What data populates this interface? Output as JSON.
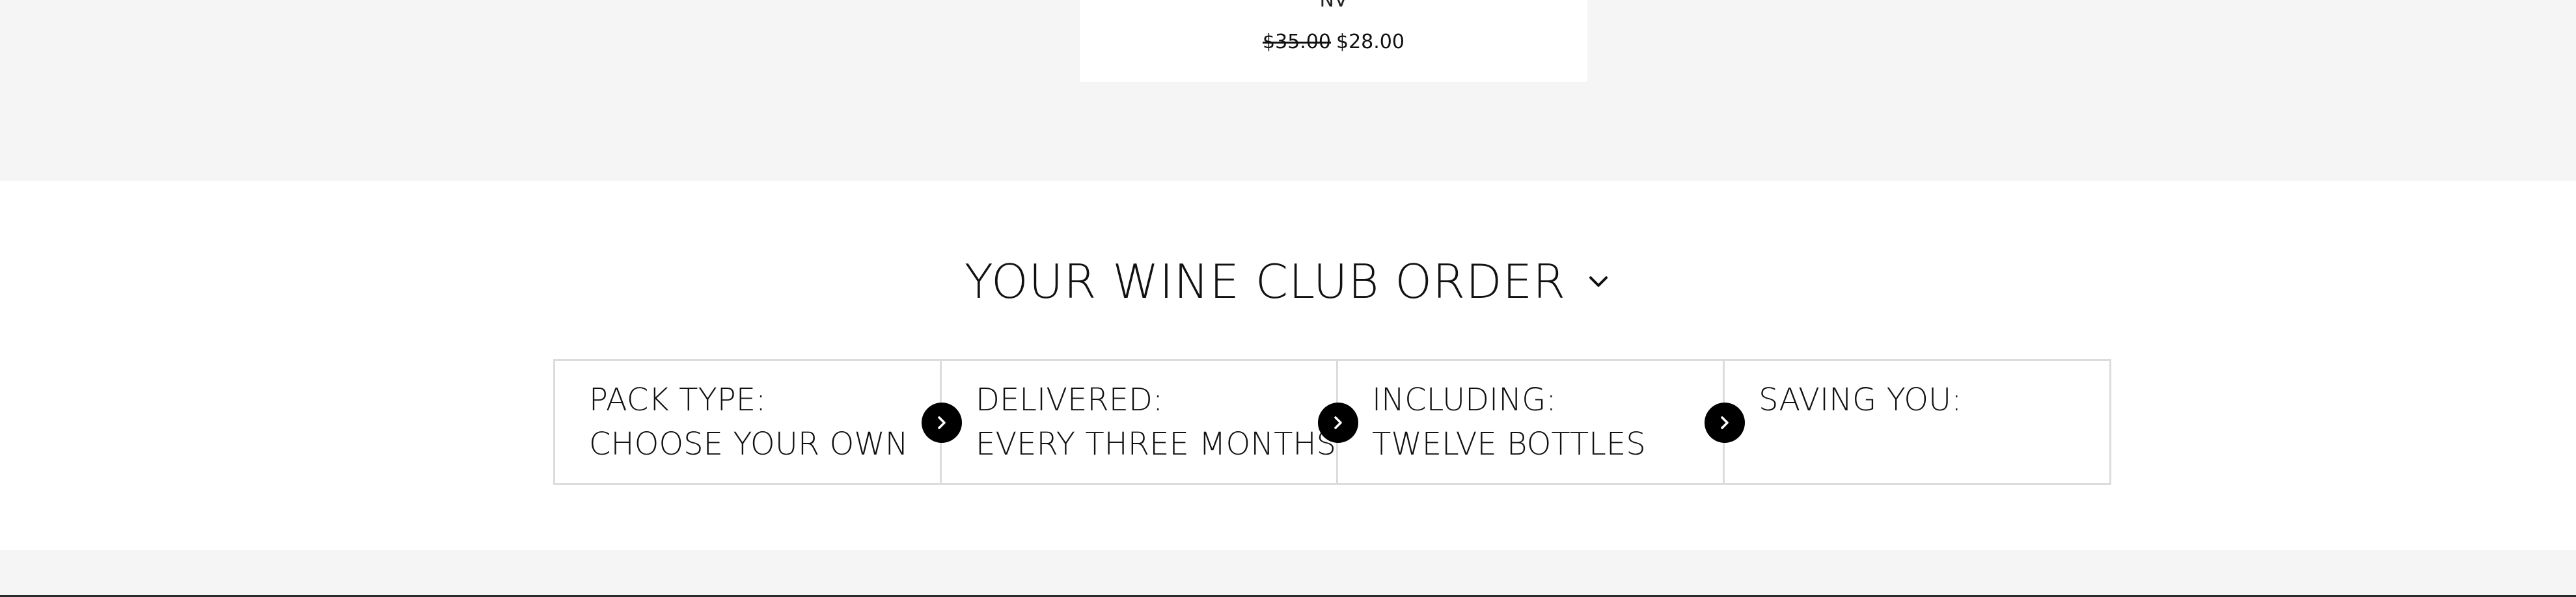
{
  "product": {
    "vintage": "NV",
    "price_original": "$35.00",
    "price_sale": "$28.00"
  },
  "order": {
    "heading": "YOUR WINE CLUB ORDER",
    "heading_icon": "chevron-down-icon",
    "summary": [
      {
        "label": "PACK TYPE:",
        "value": "CHOOSE YOUR OWN"
      },
      {
        "label": "DELIVERED:",
        "value": "EVERY THREE MONTHS"
      },
      {
        "label": "INCLUDING:",
        "value": "TWELVE BOTTLES"
      },
      {
        "label": "SAVING YOU:",
        "value": ""
      }
    ],
    "step_icon": "chevron-right-icon"
  },
  "colors": {
    "page_background": "#f5f5f5",
    "section_background": "#ffffff",
    "text": "#111111",
    "border": "#dcdcdc",
    "arrow_button": "#000000"
  }
}
